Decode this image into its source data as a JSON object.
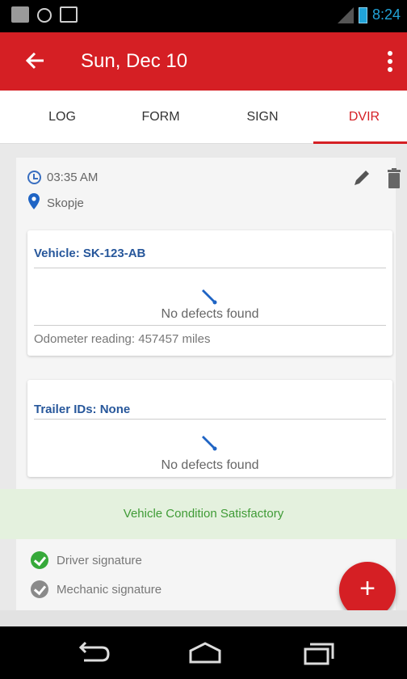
{
  "status_bar": {
    "time": "8:24",
    "icons": [
      "message-icon",
      "circle-icon",
      "mail-icon",
      "signal-icon",
      "battery-icon"
    ]
  },
  "app_bar": {
    "title": "Sun, Dec 10",
    "back_icon": "back-arrow-icon",
    "menu_icon": "more-vert-icon",
    "color": "#d51f24"
  },
  "tabs": [
    {
      "label": "LOG",
      "active": false
    },
    {
      "label": "FORM",
      "active": false
    },
    {
      "label": "SIGN",
      "active": false
    },
    {
      "label": "DVIR",
      "active": true
    }
  ],
  "report": {
    "time": "03:35 AM",
    "location": "Skopje",
    "vehicle": {
      "heading": "Vehicle: SK-123-AB",
      "defects": "No defects found",
      "odometer": "Odometer reading: 457457 miles"
    },
    "trailer": {
      "heading": "Trailer IDs: None",
      "defects": "No defects found"
    },
    "condition": "Vehicle Condition Satisfactory",
    "signatures": [
      {
        "label": "Driver signature",
        "status": "signed"
      },
      {
        "label": "Mechanic signature",
        "status": "unsigned"
      }
    ]
  },
  "fab": {
    "label": "+"
  },
  "colors": {
    "accent": "#d51f24",
    "link_blue": "#27579b",
    "success_green": "#36a93a",
    "condition_bg": "#e4f1de"
  }
}
